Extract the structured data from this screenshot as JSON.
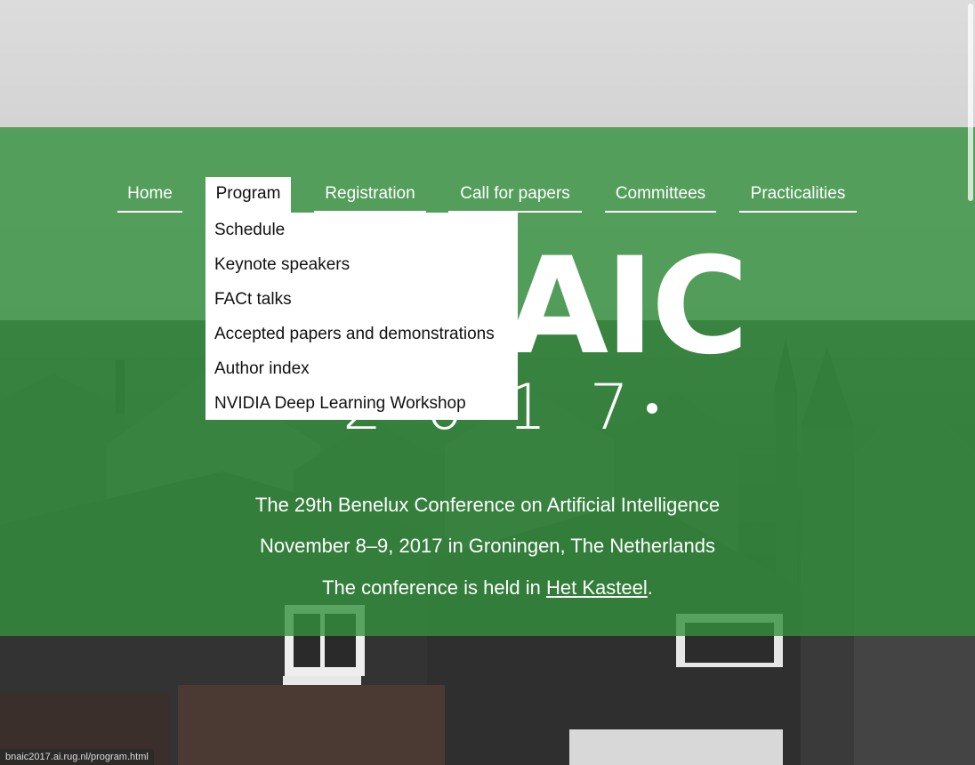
{
  "nav": {
    "items": [
      {
        "label": "Home"
      },
      {
        "label": "Program"
      },
      {
        "label": "Registration"
      },
      {
        "label": "Call for papers"
      },
      {
        "label": "Committees"
      },
      {
        "label": "Practicalities"
      }
    ],
    "active": "Program"
  },
  "dropdown": {
    "items": [
      {
        "label": "Schedule"
      },
      {
        "label": "Keynote speakers"
      },
      {
        "label": "FACt talks"
      },
      {
        "label": "Accepted papers and demonstrations"
      },
      {
        "label": "Author index"
      },
      {
        "label": "NVIDIA Deep Learning Workshop"
      }
    ]
  },
  "logo": {
    "text": "AIC",
    "year": "2017"
  },
  "info": {
    "line1": "The 29th Benelux Conference on Artificial Intelligence",
    "line2": "November 8–9, 2017 in Groningen, The Netherlands",
    "line3_prefix": "The conference is held in ",
    "line3_link": "Het Kasteel",
    "line3_suffix": "."
  },
  "status_bar": {
    "url": "bnaic2017.ai.rug.nl/program.html"
  },
  "colors": {
    "overlay_green": "#34913e",
    "nav_text": "#ffffff",
    "dropdown_bg": "#ffffff"
  }
}
